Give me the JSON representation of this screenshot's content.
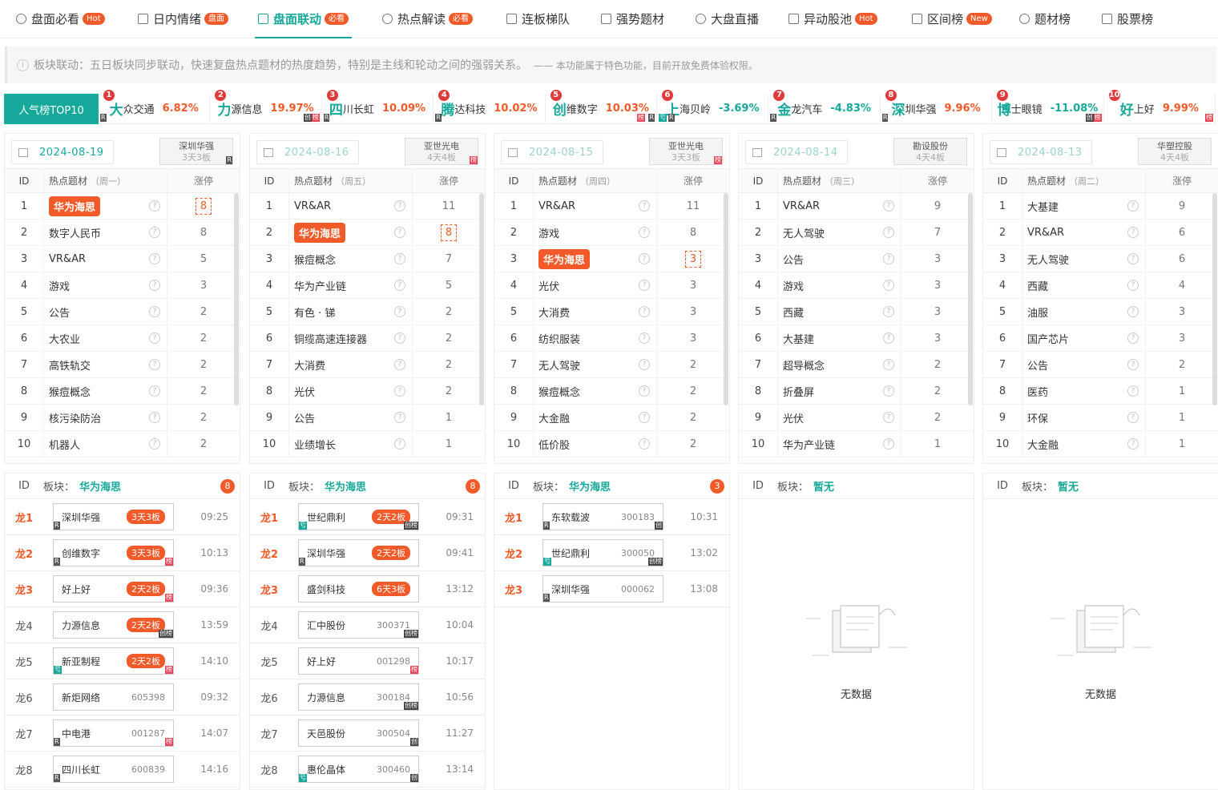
{
  "nav": [
    {
      "label": "盘面必看",
      "badge": "Hot",
      "active": false
    },
    {
      "label": "日内情绪",
      "badge": "盘面",
      "active": false
    },
    {
      "label": "盘面联动",
      "badge": "必看",
      "active": true
    },
    {
      "label": "热点解读",
      "badge": "必看",
      "active": false
    },
    {
      "label": "连板梯队",
      "badge": "",
      "active": false
    },
    {
      "label": "强势题材",
      "badge": "",
      "active": false
    },
    {
      "label": "大盘直播",
      "badge": "",
      "active": false
    },
    {
      "label": "异动股池",
      "badge": "Hot",
      "active": false
    },
    {
      "label": "区间榜",
      "badge": "New",
      "active": false
    },
    {
      "label": "题材榜",
      "badge": "",
      "active": false
    },
    {
      "label": "股票榜",
      "badge": "",
      "active": false
    }
  ],
  "notice": {
    "text": "板块联动：五日板块同步联动，快速复盘热点题材的热度趋势，特别是主线和轮动之间的强弱关系。",
    "sub": "—— 本功能属于特色功能，目前开放免费体验权限。"
  },
  "top10": {
    "title": "人气榜TOP10",
    "items": [
      {
        "rank": "1",
        "first": "大",
        "rest": "众交通",
        "pct": "6.82%",
        "dir": "up",
        "tags": [
          "R"
        ]
      },
      {
        "rank": "2",
        "first": "力",
        "rest": "源信息",
        "pct": "19.97%",
        "dir": "up",
        "tags": [
          "创",
          "榜"
        ]
      },
      {
        "rank": "3",
        "first": "四",
        "rest": "川长虹",
        "pct": "10.09%",
        "dir": "up",
        "tags": [
          "R"
        ]
      },
      {
        "rank": "4",
        "first": "腾",
        "rest": "达科技",
        "pct": "10.02%",
        "dir": "up",
        "tags": [
          "R"
        ]
      },
      {
        "rank": "5",
        "first": "创",
        "rest": "维数字",
        "pct": "10.03%",
        "dir": "up",
        "tags": [
          "R",
          "榜"
        ]
      },
      {
        "rank": "6",
        "first": "上",
        "rest": "海贝岭",
        "pct": "-3.69%",
        "dir": "dn",
        "tags": [
          "亏",
          "R"
        ]
      },
      {
        "rank": "7",
        "first": "金",
        "rest": "龙汽车",
        "pct": "-4.83%",
        "dir": "dn",
        "tags": [
          "R"
        ]
      },
      {
        "rank": "8",
        "first": "深",
        "rest": "圳华强",
        "pct": "9.96%",
        "dir": "up",
        "tags": [
          "R"
        ]
      },
      {
        "rank": "9",
        "first": "博",
        "rest": "士眼镜",
        "pct": "-11.08%",
        "dir": "dn",
        "tags": [
          "创",
          "榜"
        ]
      },
      {
        "rank": "10",
        "first": "好",
        "rest": "上好",
        "pct": "9.99%",
        "dir": "up",
        "tags": [
          "榜"
        ]
      }
    ]
  },
  "headers": {
    "id": "ID",
    "topic": "热点题材",
    "zt": "涨停",
    "board": "板块："
  },
  "days": [
    {
      "date": "2024-08-19",
      "week": "（周一）",
      "stock": "深圳华强",
      "streak": "3天3板",
      "tag": "R",
      "hl": 1,
      "rows": [
        [
          "1",
          "华为海思",
          "8"
        ],
        [
          "2",
          "数字人民币",
          "8"
        ],
        [
          "3",
          "VR&AR",
          "5"
        ],
        [
          "4",
          "游戏",
          "3"
        ],
        [
          "5",
          "公告",
          "2"
        ],
        [
          "6",
          "大农业",
          "2"
        ],
        [
          "7",
          "高铁轨交",
          "2"
        ],
        [
          "8",
          "猴痘概念",
          "2"
        ],
        [
          "9",
          "核污染防治",
          "2"
        ],
        [
          "10",
          "机器人",
          "2"
        ]
      ]
    },
    {
      "date": "2024-08-16",
      "week": "（周五）",
      "stock": "亚世光电",
      "streak": "4天4板",
      "tag": "榜",
      "hl": 2,
      "rows": [
        [
          "1",
          "VR&AR",
          "11"
        ],
        [
          "2",
          "华为海思",
          "8"
        ],
        [
          "3",
          "猴痘概念",
          "7"
        ],
        [
          "4",
          "华为产业链",
          "5"
        ],
        [
          "5",
          "有色 · 锑",
          "2"
        ],
        [
          "6",
          "铜缆高速连接器",
          "2"
        ],
        [
          "7",
          "大消费",
          "2"
        ],
        [
          "8",
          "光伏",
          "2"
        ],
        [
          "9",
          "公告",
          "1"
        ],
        [
          "10",
          "业绩增长",
          "1"
        ]
      ]
    },
    {
      "date": "2024-08-15",
      "week": "（周四）",
      "stock": "亚世光电",
      "streak": "3天3板",
      "tag": "榜",
      "hl": 3,
      "rows": [
        [
          "1",
          "VR&AR",
          "11"
        ],
        [
          "2",
          "游戏",
          "8"
        ],
        [
          "3",
          "华为海思",
          "3"
        ],
        [
          "4",
          "光伏",
          "3"
        ],
        [
          "5",
          "大消费",
          "3"
        ],
        [
          "6",
          "纺织服装",
          "3"
        ],
        [
          "7",
          "无人驾驶",
          "2"
        ],
        [
          "8",
          "猴痘概念",
          "2"
        ],
        [
          "9",
          "大金融",
          "2"
        ],
        [
          "10",
          "低价股",
          "2"
        ]
      ]
    },
    {
      "date": "2024-08-14",
      "week": "（周三）",
      "stock": "勘设股份",
      "streak": "4天4板",
      "tag": "",
      "hl": 0,
      "rows": [
        [
          "1",
          "VR&AR",
          "9"
        ],
        [
          "2",
          "无人驾驶",
          "7"
        ],
        [
          "3",
          "公告",
          "3"
        ],
        [
          "4",
          "游戏",
          "3"
        ],
        [
          "5",
          "西藏",
          "3"
        ],
        [
          "6",
          "大基建",
          "3"
        ],
        [
          "7",
          "超导概念",
          "2"
        ],
        [
          "8",
          "折叠屏",
          "2"
        ],
        [
          "9",
          "光伏",
          "2"
        ],
        [
          "10",
          "华为产业链",
          "1"
        ]
      ]
    },
    {
      "date": "2024-08-13",
      "week": "（周二）",
      "stock": "华塑控股",
      "streak": "4天4板",
      "tag": "",
      "hl": 0,
      "rows": [
        [
          "1",
          "大基建",
          "9"
        ],
        [
          "2",
          "VR&AR",
          "6"
        ],
        [
          "3",
          "无人驾驶",
          "6"
        ],
        [
          "4",
          "西藏",
          "4"
        ],
        [
          "5",
          "油服",
          "3"
        ],
        [
          "6",
          "国产芯片",
          "3"
        ],
        [
          "7",
          "公告",
          "2"
        ],
        [
          "8",
          "医药",
          "1"
        ],
        [
          "9",
          "环保",
          "1"
        ],
        [
          "10",
          "大金融",
          "1"
        ]
      ]
    }
  ],
  "boards": [
    {
      "name": "华为海思",
      "count": "8",
      "rows": [
        [
          "龙1",
          "深圳华强",
          "",
          "3天3板",
          "09:25",
          "R",
          ""
        ],
        [
          "龙2",
          "创维数字",
          "",
          "3天3板",
          "10:13",
          "R",
          "榜"
        ],
        [
          "龙3",
          "好上好",
          "",
          "2天2板",
          "09:36",
          "",
          "榜"
        ],
        [
          "龙4",
          "力源信息",
          "",
          "2天2板",
          "13:59",
          "",
          "创榜"
        ],
        [
          "龙5",
          "新亚制程",
          "",
          "2天2板",
          "14:10",
          "亏",
          "榜"
        ],
        [
          "龙6",
          "新炬网络",
          "605398",
          "",
          "09:32",
          "",
          ""
        ],
        [
          "龙7",
          "中电港",
          "001287",
          "",
          "14:07",
          "R",
          "榜"
        ],
        [
          "龙8",
          "四川长虹",
          "600839",
          "",
          "14:16",
          "R",
          ""
        ]
      ]
    },
    {
      "name": "华为海思",
      "count": "8",
      "rows": [
        [
          "龙1",
          "世纪鼎利",
          "",
          "2天2板",
          "09:31",
          "亏",
          "创榜"
        ],
        [
          "龙2",
          "深圳华强",
          "",
          "2天2板",
          "09:41",
          "R",
          ""
        ],
        [
          "龙3",
          "盛剑科技",
          "",
          "6天3板",
          "13:12",
          "",
          ""
        ],
        [
          "龙4",
          "汇中股份",
          "300371",
          "",
          "10:04",
          "",
          "创榜"
        ],
        [
          "龙5",
          "好上好",
          "001298",
          "",
          "10:17",
          "",
          "榜"
        ],
        [
          "龙6",
          "力源信息",
          "300184",
          "",
          "10:56",
          "",
          "创榜"
        ],
        [
          "龙7",
          "天邑股份",
          "300504",
          "",
          "11:27",
          "",
          "创"
        ],
        [
          "龙8",
          "惠伦晶体",
          "300460",
          "",
          "13:14",
          "亏",
          "创"
        ]
      ]
    },
    {
      "name": "华为海思",
      "count": "3",
      "rows": [
        [
          "龙1",
          "东软载波",
          "300183",
          "",
          "10:31",
          "R",
          "创"
        ],
        [
          "龙2",
          "世纪鼎利",
          "300050",
          "",
          "13:02",
          "亏",
          "创榜"
        ],
        [
          "龙3",
          "深圳华强",
          "000062",
          "",
          "13:08",
          "R",
          ""
        ]
      ]
    },
    {
      "name": "暂无",
      "count": "",
      "rows": [],
      "empty": "无数据"
    },
    {
      "name": "暂无",
      "count": "",
      "rows": [],
      "empty": "无数据"
    }
  ]
}
